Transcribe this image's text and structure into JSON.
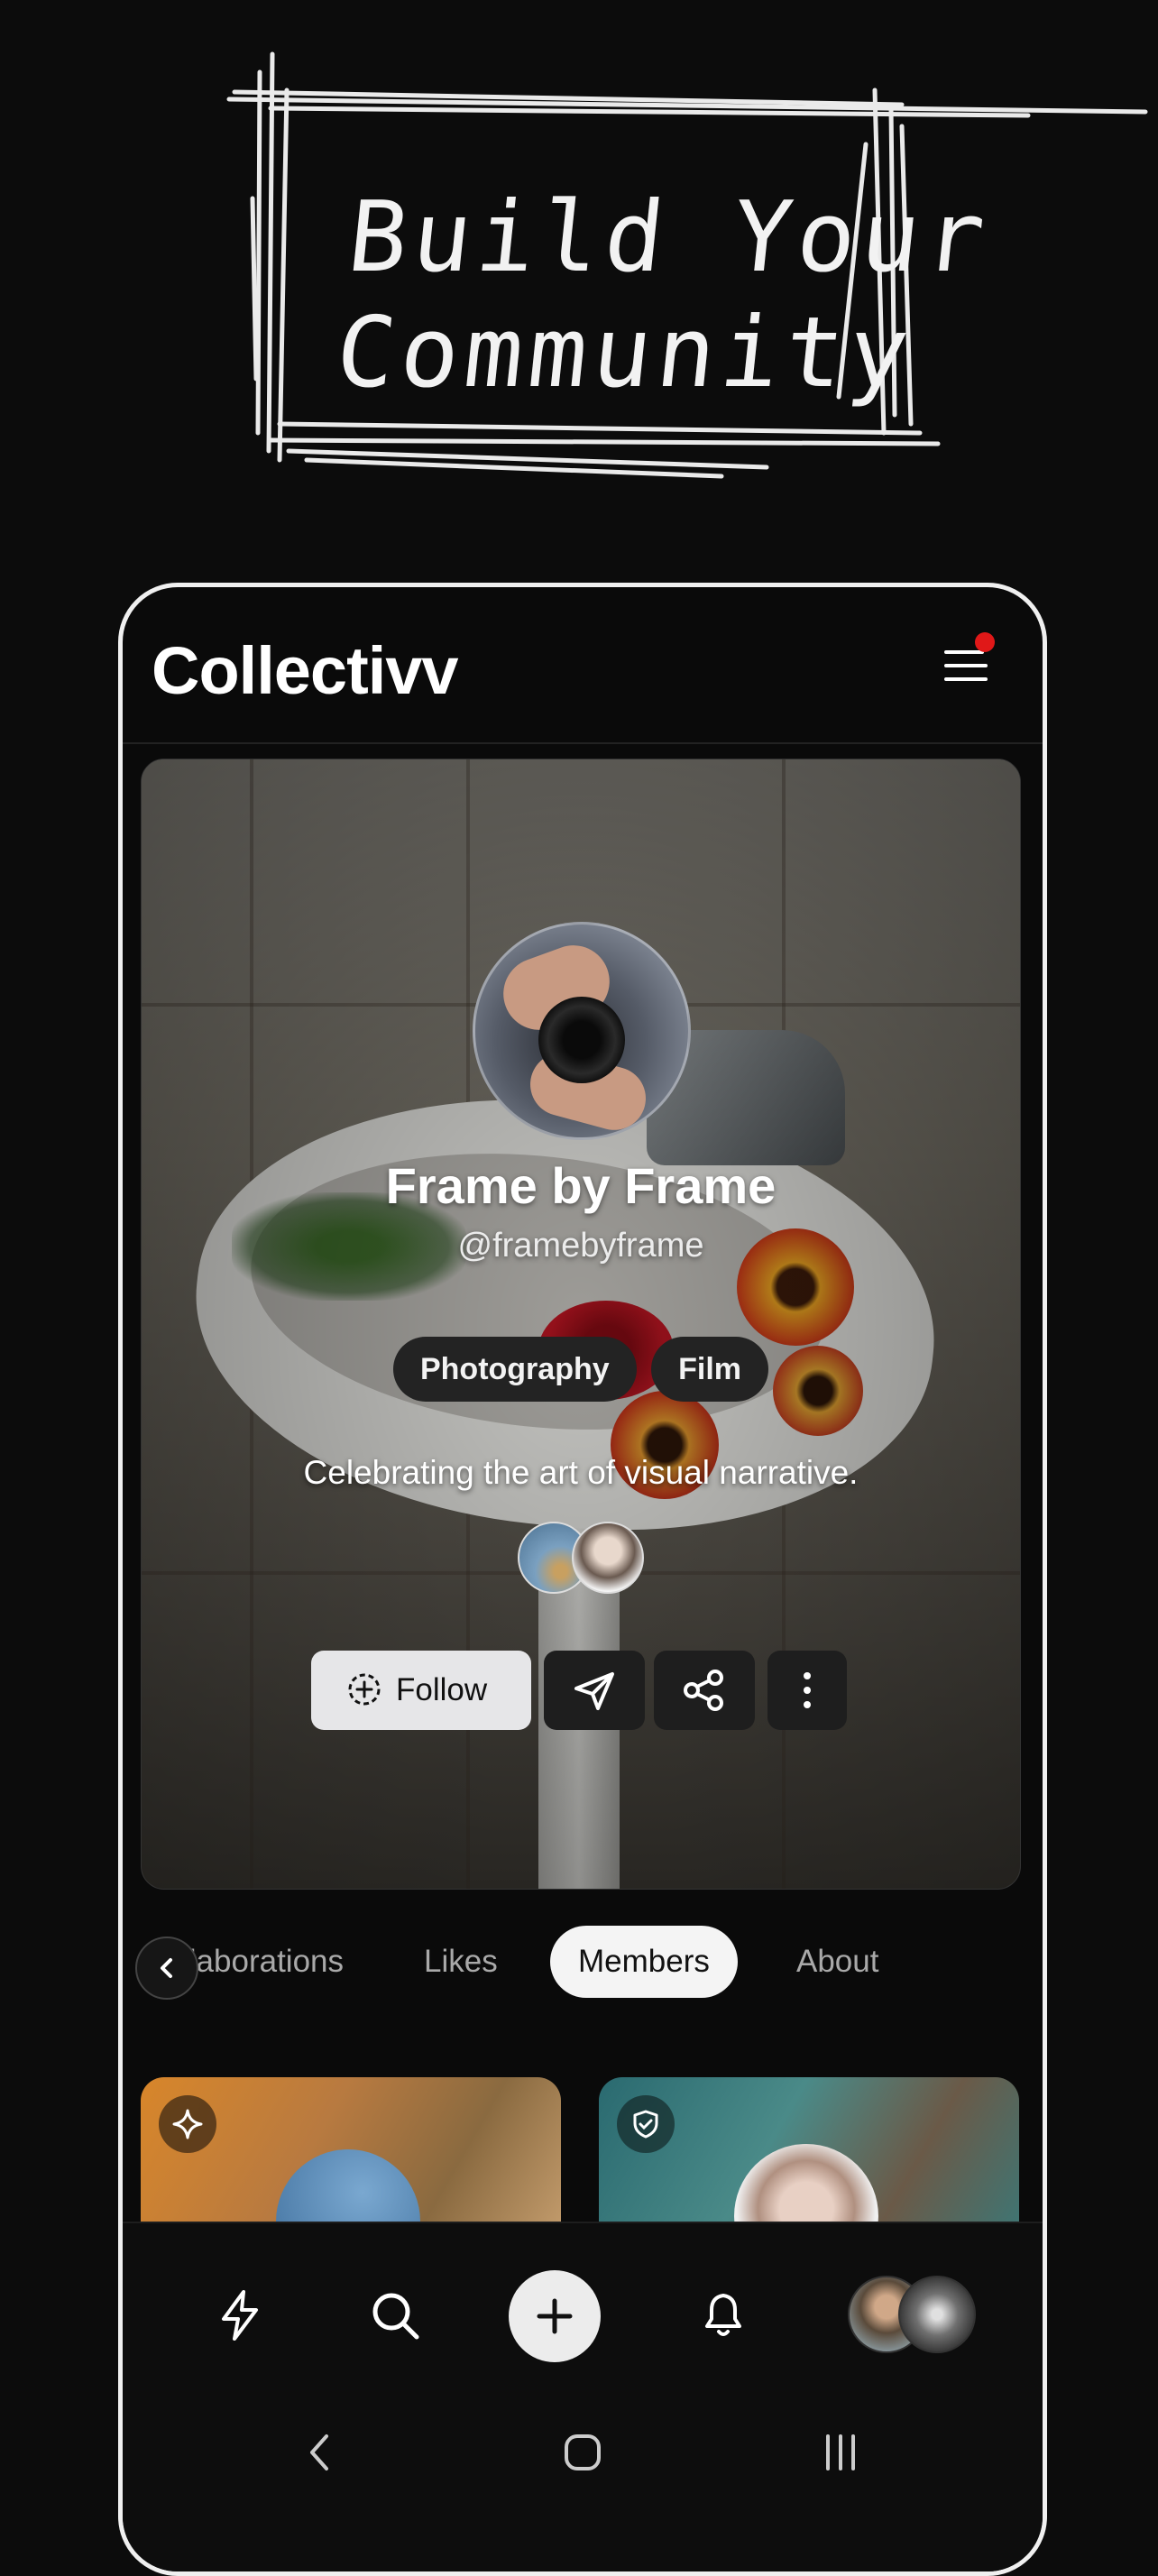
{
  "headline": {
    "line1": "Build Your",
    "line2": "Community"
  },
  "app": {
    "title": "Collectivv"
  },
  "profile": {
    "name": "Frame by Frame",
    "handle": "@framebyframe",
    "tags": [
      "Photography",
      "Film"
    ],
    "bio": "Celebrating the art of visual narrative."
  },
  "actions": {
    "follow_label": "Follow"
  },
  "tabs": [
    {
      "label": "llaborations"
    },
    {
      "label": "Likes"
    },
    {
      "label": "Members"
    },
    {
      "label": "About"
    }
  ],
  "icons": {
    "menu": "hamburger-menu-icon",
    "follow": "plus-circle-dashed-icon",
    "send": "paper-plane-icon",
    "share": "share-nodes-icon",
    "more": "vertical-ellipsis-icon",
    "back": "chevron-left-icon",
    "activity": "lightning-icon",
    "search": "search-icon",
    "create": "plus-icon",
    "notifications": "bell-icon",
    "card1_badge": "sparkle-icon",
    "card2_badge": "shield-check-icon"
  },
  "colors": {
    "accent_dot": "#e01818",
    "follow_bg": "#e6e6e8",
    "active_tab_bg": "#f4f4f4",
    "background": "#0c0c0c"
  }
}
